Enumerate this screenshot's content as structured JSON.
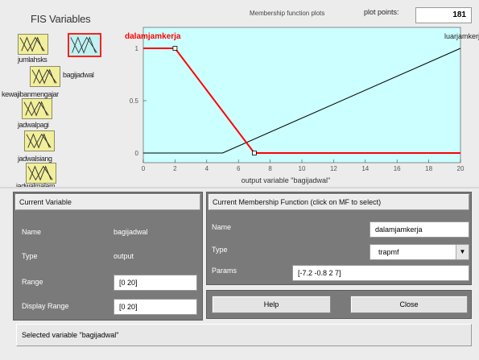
{
  "fis": {
    "title": "FIS Variables",
    "inputs": [
      "jumlahsks",
      "kewajibanmengajar",
      "jadwalpagi",
      "jadwalsiang",
      "jadwalmalam"
    ],
    "output": "bagijadwal"
  },
  "plot": {
    "header": "Membership function plots",
    "points_label": "plot points:",
    "points_value": "181",
    "xlabel": "output variable \"bagijadwal\"",
    "mf_names": [
      "dalamjamkerja",
      "luarjamkerja"
    ]
  },
  "chart_data": {
    "type": "line",
    "xlim": [
      0,
      20
    ],
    "ylim": [
      0,
      1
    ],
    "xticks": [
      0,
      2,
      4,
      6,
      8,
      10,
      12,
      14,
      16,
      18,
      20
    ],
    "yticks": [
      0,
      0.5,
      1
    ],
    "series": [
      {
        "name": "dalamjamkerja",
        "color": "#ff0000",
        "selected": true,
        "x": [
          0,
          2,
          7,
          20
        ],
        "y": [
          1,
          1,
          0,
          0
        ]
      },
      {
        "name": "luarjamkerja",
        "color": "#000000",
        "selected": false,
        "x": [
          0,
          5,
          20
        ],
        "y": [
          0,
          0,
          1
        ]
      }
    ]
  },
  "current_variable": {
    "heading": "Current Variable",
    "name_label": "Name",
    "name_value": "bagijadwal",
    "type_label": "Type",
    "type_value": "output",
    "range_label": "Range",
    "range_value": "[0 20]",
    "display_range_label": "Display Range",
    "display_range_value": "[0 20]"
  },
  "current_mf": {
    "heading": "Current Membership Function (click on MF to select)",
    "name_label": "Name",
    "name_value": "dalamjamkerja",
    "type_label": "Type",
    "type_value": "trapmf",
    "params_label": "Params",
    "params_value": "[-7.2 -0.8 2 7]"
  },
  "buttons": {
    "help": "Help",
    "close": "Close"
  },
  "status": "Selected variable \"bagijadwal\"",
  "colors": {
    "plot_bg": "#ccffff",
    "selected_mf": "#ff0000",
    "panel_dark": "#7a7a7a"
  }
}
